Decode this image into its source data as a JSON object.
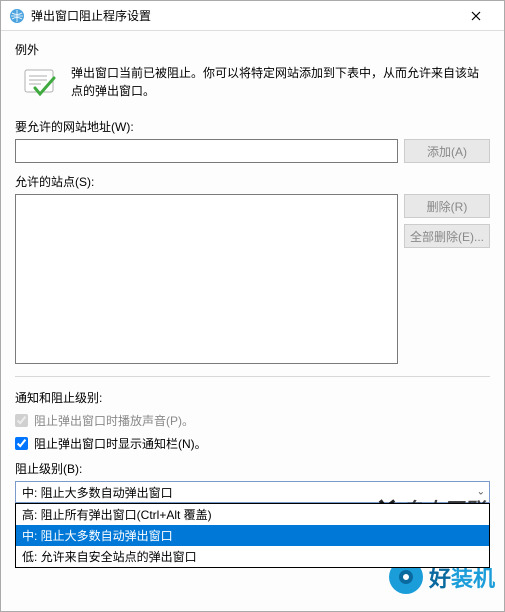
{
  "titlebar": {
    "title": "弹出窗口阻止程序设置"
  },
  "exceptions": {
    "heading": "例外",
    "info": "弹出窗口当前已被阻止。你可以将特定网站添加到下表中，从而允许来自该站点的弹出窗口。",
    "address_label": "要允许的网站地址(W):",
    "address_value": "",
    "add_btn": "添加(A)",
    "allowed_label": "允许的站点(S):",
    "remove_btn": "删除(R)",
    "remove_all_btn": "全部删除(E)..."
  },
  "notify": {
    "heading": "通知和阻止级别:",
    "sound_checkbox": "阻止弹出窗口时播放声音(P)。",
    "infobar_checkbox": "阻止弹出窗口时显示通知栏(N)。",
    "level_label": "阻止级别(B):",
    "selected": "中: 阻止大多数自动弹出窗口",
    "options": [
      "高: 阻止所有弹出窗口(Ctrl+Alt 覆盖)",
      "中: 阻止大多数自动弹出窗口",
      "低: 允许来自安全站点的弹出窗口"
    ]
  },
  "watermarks": {
    "wm1": "自由互联",
    "wm2a": "好",
    "wm2b": "装机"
  }
}
